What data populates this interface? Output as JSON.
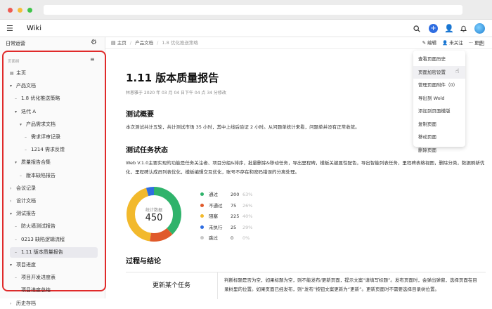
{
  "app": {
    "title": "Wiki"
  },
  "colors": {
    "accent": "#2f6de1",
    "highlight_border": "#e02a2a",
    "pass": "#2fb36b",
    "fail": "#e05a2b",
    "blocked": "#f2b92c",
    "not_run": "#2f6de1",
    "skipped": "#c8c8c8"
  },
  "sidebar": {
    "title": "日常运营",
    "section_label": "页面树",
    "items": [
      {
        "label": "主页",
        "level": 0,
        "arrow": "",
        "icon": true
      },
      {
        "label": "产品文档",
        "level": 0,
        "arrow": "▾"
      },
      {
        "label": "1.8 优化推送策略",
        "level": 1,
        "arrow": "–"
      },
      {
        "label": "迭代 A",
        "level": 1,
        "arrow": "▾"
      },
      {
        "label": "产品需求文档",
        "level": 2,
        "arrow": "▾"
      },
      {
        "label": "需求评审记录",
        "level": 3,
        "arrow": "–"
      },
      {
        "label": "1214 需求反馈",
        "level": 3,
        "arrow": "–"
      },
      {
        "label": "质量报告合集",
        "level": 1,
        "arrow": "▾"
      },
      {
        "label": "版本缺陷报告",
        "level": 2,
        "arrow": "–"
      },
      {
        "label": "会议记录",
        "level": 0,
        "arrow": "›"
      },
      {
        "label": "设计文档",
        "level": 0,
        "arrow": "›"
      },
      {
        "label": "测试报告",
        "level": 0,
        "arrow": "▾"
      },
      {
        "label": "防火墙测试报告",
        "level": 1,
        "arrow": "–"
      },
      {
        "label": "0213 缺陷逻辑流程",
        "level": 1,
        "arrow": "–"
      },
      {
        "label": "1.11 版本质量报告",
        "level": 1,
        "arrow": "–",
        "selected": true
      },
      {
        "label": "项目进度",
        "level": 0,
        "arrow": "▾"
      },
      {
        "label": "项目开发进度表",
        "level": 1,
        "arrow": "–"
      },
      {
        "label": "项目进度总结",
        "level": 1,
        "arrow": "–"
      },
      {
        "label": "历史存档",
        "level": 0,
        "arrow": "›"
      }
    ]
  },
  "breadcrumbs": [
    "主页",
    "产品文档",
    "1.8 优化推送策略"
  ],
  "actions": {
    "edit": "编辑",
    "follow": "未关注",
    "more": "更多"
  },
  "menu": {
    "items": [
      "查看页面历史",
      "页面加密设置",
      "管理页面附件（0）",
      "导出到 Wold",
      "添加到页面模版",
      "复制页面",
      "移动页面",
      "删除页面"
    ]
  },
  "page": {
    "title": "1.11 版本质量报告",
    "meta": "林恩雅于 2020 年 03 月 04 日下午 04 点 34 分修改",
    "sections": {
      "overview_title": "测试概要",
      "overview_text": "本次测试共计五轮，共计测试市场 35 小时，其中上线后验证 2 小时。从问题单统计来看，问题单并没有正常收敛。",
      "status_title": "测试任务状态",
      "status_text": "Web V.1.0主要实现的功能是任务关注者、项目分组&排序，批量删除&移动任务，导出里程碑，模板关键属性配色，导出智能列表任务，里程碑表格视图，删除分类，数据刷新优化，里程碑认成员列表优化，模板编辑交互优化，账号不存在和密码错误的分离处理。",
      "conclusion_title": "过程与结论"
    },
    "table": {
      "left": "更新某个任务",
      "right": "判断标题是否为空，如果标题为空，则不能发布/更新页面，提示文案“请填写标题”。发布页面时，会弹出弹窗，选择页面在目录树里的位置。如果页面已经发布，则“发布”按钮文案更新为“更新”。更新页面时不需要选择目录树位置。"
    }
  },
  "chart_data": {
    "type": "pie",
    "center_label": "统计数据",
    "center_value": "450",
    "categories": [
      "通过",
      "不通过",
      "阻塞",
      "未执行",
      "跳过"
    ],
    "values": [
      200,
      75,
      225,
      25,
      0
    ],
    "percents": [
      "63%",
      "26%",
      "40%",
      "29%",
      "0%"
    ],
    "colors": [
      "#2fb36b",
      "#e05a2b",
      "#f2b92c",
      "#2f6de1",
      "#c8c8c8"
    ]
  }
}
